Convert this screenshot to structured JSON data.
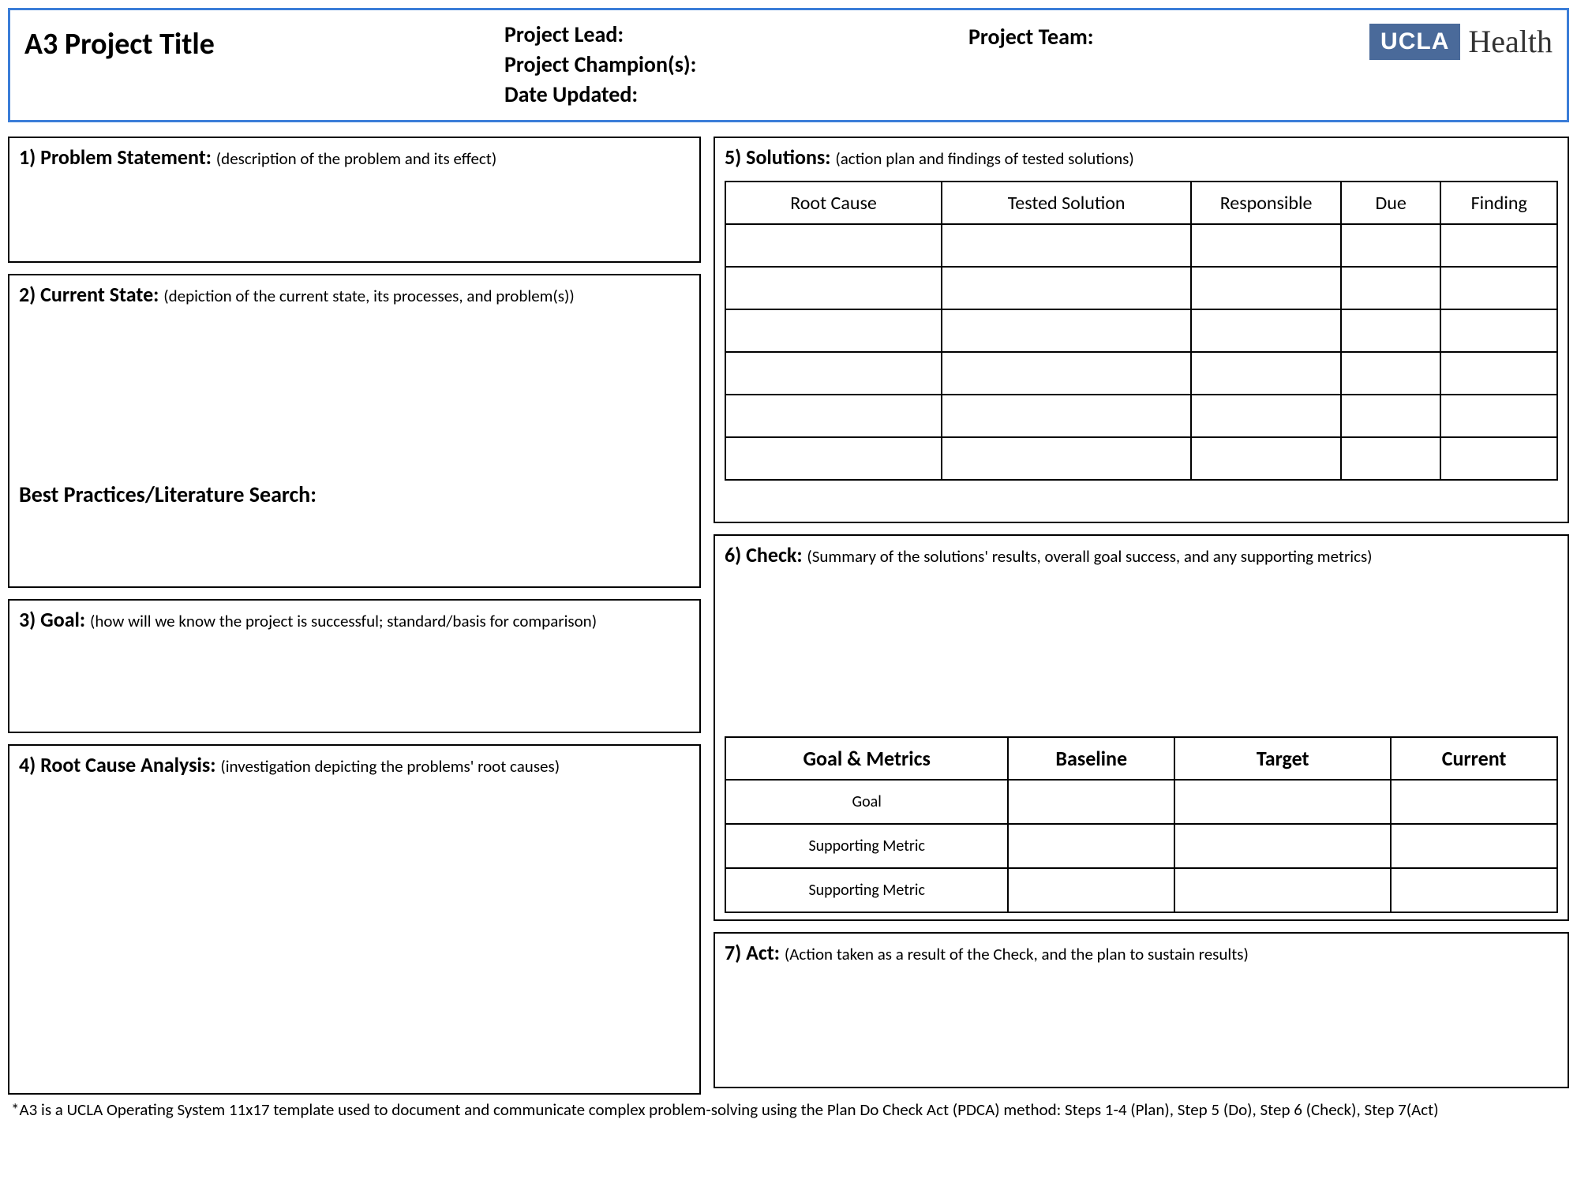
{
  "header": {
    "title": "A3 Project Title",
    "lead_label": "Project Lead:",
    "champion_label": "Project Champion(s):",
    "date_label": "Date Updated:",
    "team_label": "Project Team:",
    "logo_badge": "UCLA",
    "logo_text": "Health"
  },
  "sections": {
    "problem": {
      "num_title": "1) Problem Statement: ",
      "desc": "(description of the problem and its effect)"
    },
    "current": {
      "num_title": "2) Current State: ",
      "desc": "(depiction of the current state, its processes, and problem(s))",
      "lit_heading": "Best Practices/Literature Search:"
    },
    "goal": {
      "num_title": "3) Goal: ",
      "desc": "(how will we know the project is successful; standard/basis for comparison)"
    },
    "root": {
      "num_title": "4) Root Cause Analysis: ",
      "desc": "(investigation depicting the problems' root causes)"
    },
    "solutions": {
      "num_title": "5) Solutions: ",
      "desc": "(action plan and findings of tested solutions)"
    },
    "check": {
      "num_title": "6) Check: ",
      "desc": "(Summary of the solutions' results, overall goal success, and any supporting metrics)"
    },
    "act": {
      "num_title": "7) Act: ",
      "desc": "(Action taken as a result of the Check, and the plan to sustain results)"
    }
  },
  "solutions_table": {
    "headers": [
      "Root Cause",
      "Tested Solution",
      "Responsible",
      "Due",
      "Finding"
    ],
    "rows": 6
  },
  "check_table": {
    "headers": [
      "Goal & Metrics",
      "Baseline",
      "Target",
      "Current"
    ],
    "rows": [
      "Goal",
      "Supporting Metric",
      "Supporting Metric"
    ]
  },
  "footnote": "*A3 is a UCLA Operating System 11x17 template used to document and communicate complex problem-solving using the Plan Do Check Act (PDCA) method: Steps 1-4 (Plan), Step 5 (Do), Step 6 (Check), Step 7(Act)"
}
